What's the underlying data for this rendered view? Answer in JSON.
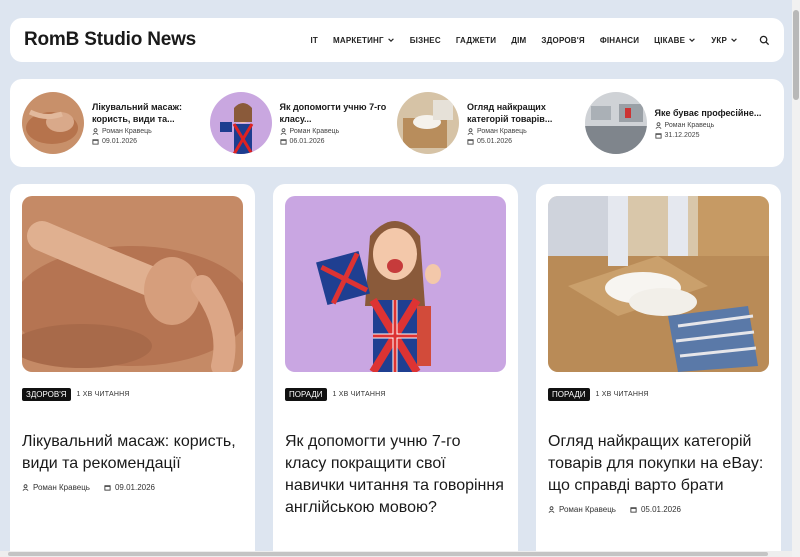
{
  "site": {
    "logo": "RomB Studio News"
  },
  "nav": {
    "items": [
      {
        "label": "IT",
        "dropdown": false
      },
      {
        "label": "МАРКЕТИНГ",
        "dropdown": true
      },
      {
        "label": "БІЗНЕС",
        "dropdown": false
      },
      {
        "label": "ГАДЖЕТИ",
        "dropdown": false
      },
      {
        "label": "ДІМ",
        "dropdown": false
      },
      {
        "label": "ЗДОРОВ'Я",
        "dropdown": false
      },
      {
        "label": "ФІНАНСИ",
        "dropdown": false
      },
      {
        "label": "ЦІКАВЕ",
        "dropdown": true
      },
      {
        "label": "УКР",
        "dropdown": true
      }
    ],
    "search_icon": "search-icon"
  },
  "ticker": [
    {
      "title": "Лікувальний масаж: користь, види та...",
      "author": "Роман Кравець",
      "date": "09.01.2026"
    },
    {
      "title": "Як допомогти учню 7-го класу...",
      "author": "Роман Кравець",
      "date": "06.01.2026"
    },
    {
      "title": "Огляд найкращих категорій товарів...",
      "author": "Роман Кравець",
      "date": "05.01.2026"
    },
    {
      "title": "Яке буває професійне...",
      "author": "Роман Кравець",
      "date": "31.12.2025"
    }
  ],
  "cards": [
    {
      "tag": "ЗДОРОВ'Я",
      "readtime": "1 ХВ ЧИТАННЯ",
      "title": "Лікувальний масаж: користь, види та рекомендації",
      "author": "Роман Кравець",
      "date": "09.01.2026"
    },
    {
      "tag": "ПОРАДИ",
      "readtime": "1 ХВ ЧИТАННЯ",
      "title": "Як допомогти учню 7-го класу покращити свої навички читання та говоріння англійською мовою?",
      "author": "Роман Кравець",
      "date": ""
    },
    {
      "tag": "ПОРАДИ",
      "readtime": "1 ХВ ЧИТАННЯ",
      "title": "Огляд найкращих категорій товарів для покупки на eBay: що справді варто брати",
      "author": "Роман Кравець",
      "date": "05.01.2026"
    }
  ],
  "colors": {
    "page_bg": "#dde5f0",
    "card_bg": "#ffffff",
    "tag_bg": "#111111"
  }
}
